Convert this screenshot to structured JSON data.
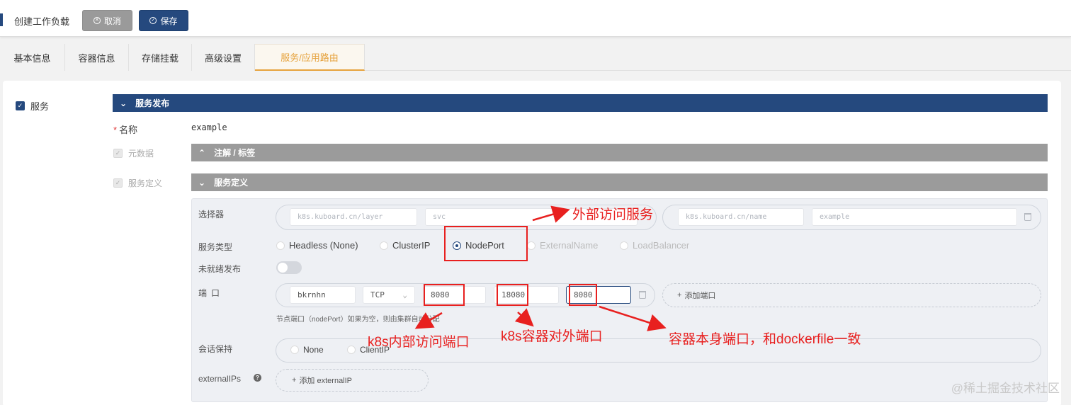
{
  "header": {
    "title": "创建工作负载",
    "cancel_label": "取消",
    "save_label": "保存"
  },
  "tabs": [
    {
      "label": "基本信息"
    },
    {
      "label": "容器信息"
    },
    {
      "label": "存储挂载"
    },
    {
      "label": "高级设置"
    },
    {
      "label": "服务/应用路由"
    }
  ],
  "service": {
    "checkbox_label": "服务",
    "section_title": "服务发布",
    "name_label": "名称",
    "name_value": "example",
    "metadata_label": "元数据",
    "annotations_title": "注解 / 标签",
    "definition_label": "服务定义",
    "definition_title": "服务定义"
  },
  "selector": {
    "label": "选择器",
    "left_key": "k8s.kuboard.cn/layer",
    "left_value": "svc",
    "right_key": "k8s.kuboard.cn/name",
    "right_value": "example"
  },
  "service_type": {
    "label": "服务类型",
    "options": [
      "Headless (None)",
      "ClusterIP",
      "NodePort",
      "ExternalName",
      "LoadBalancer"
    ],
    "selected": "NodePort"
  },
  "unready": {
    "label": "未就绪发布"
  },
  "ports": {
    "label": "端口",
    "name": "bkrnhn",
    "protocol": "TCP",
    "node_port": "8080",
    "port": "18080",
    "target_port": "8080",
    "add_label": "添加端口",
    "hint": "节点端口（nodePort）如果为空，则由集群自动分配"
  },
  "session": {
    "label": "会话保持",
    "options": [
      "None",
      "ClientIP"
    ]
  },
  "external_ips": {
    "label": "externalIPs",
    "add_label": "添加 externalIP"
  },
  "annotations": {
    "external": "外部访问服务",
    "k8s_internal": "k8s内部访问端口",
    "k8s_container_external": "k8s容器对外端口",
    "container_port": "容器本身端口，和dockerfile一致"
  },
  "watermark": "@稀土掘金技术社区",
  "colors": {
    "primary": "#25497e",
    "active_tab": "#e6a23c",
    "annotation": "#e8201f"
  }
}
